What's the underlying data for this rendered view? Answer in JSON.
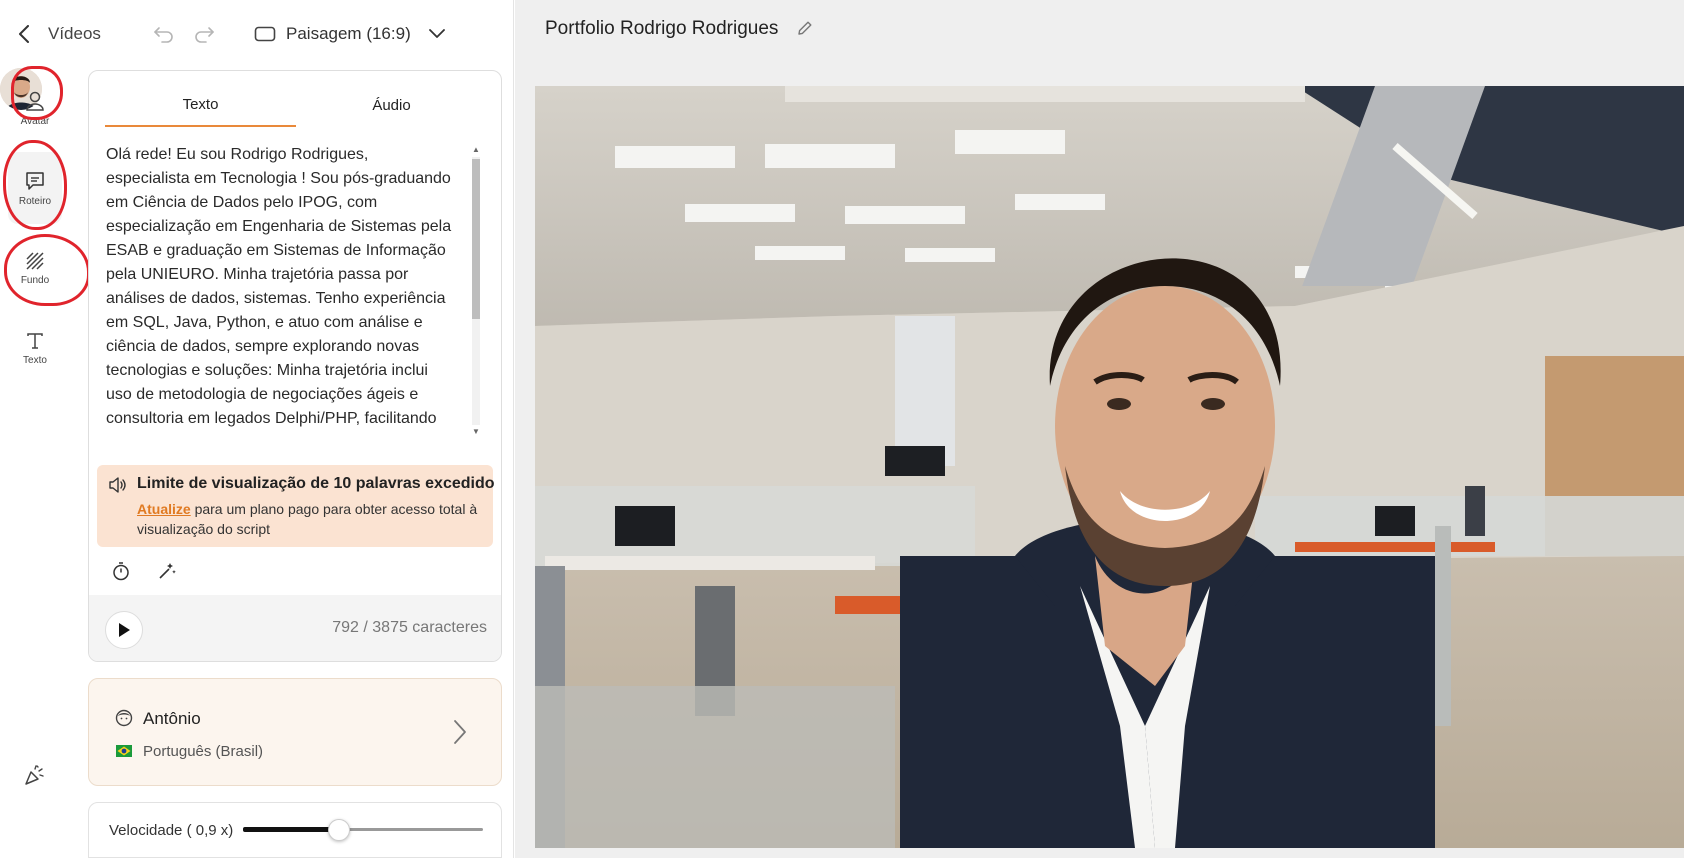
{
  "topbar": {
    "back_label": "Vídeos",
    "aspect_label": "Paisagem (16:9)"
  },
  "rail": {
    "avatar_label": "Avatar",
    "script_label": "Roteiro",
    "background_label": "Fundo",
    "text_label": "Texto"
  },
  "script": {
    "tabs": [
      "Texto",
      "Áudio"
    ],
    "text": "Olá rede! Eu sou Rodrigo Rodrigues, especialista em Tecnologia ! Sou pós-graduando em Ciência de Dados pelo IPOG, com especialização em Engenharia de Sistemas pela ESAB e graduação em Sistemas de Informação pela UNIEURO. Minha trajetória passa por análises de dados, sistemas. Tenho experiência em SQL, Java, Python, e atuo com análise e ciência de dados, sempre explorando novas tecnologias e soluções: Minha trajetória inclui uso de metodologia de negociações ágeis e consultoria em legados Delphi/PHP, facilitando decisões estratégicas.",
    "limit_title": "Limite de visualização de 10 palavras excedido",
    "upgrade_link": "Atualize",
    "limit_desc_rest": " para um plano pago para obter acesso total à visualização do script",
    "char_count": "792 / 3875 caracteres"
  },
  "voice": {
    "name": "Antônio",
    "language": "Português (Brasil)"
  },
  "speed": {
    "label": "Velocidade ( 0,9 x)",
    "value": 0.9,
    "min": 0.5,
    "max": 1.5
  },
  "project": {
    "title": "Portfolio Rodrigo Rodrigues"
  },
  "colors": {
    "accent": "#e9893a",
    "annotation": "#e0242c",
    "banner_bg": "#fbe3d2",
    "voice_bg": "#fcf5ee"
  },
  "icons": {
    "back": "chevron-left-icon",
    "undo": "undo-icon",
    "redo": "redo-icon",
    "aspect": "rectangle-icon",
    "avatar": "person-icon",
    "script": "speech-bubble-icon",
    "background": "hatch-pattern-icon",
    "text": "letter-t-icon",
    "timer": "stopwatch-icon",
    "magic": "magic-wand-icon",
    "play": "play-icon",
    "edit": "pencil-icon",
    "voice": "face-icon",
    "flag": "brazil-flag-icon",
    "celebrate": "party-popper-icon"
  }
}
